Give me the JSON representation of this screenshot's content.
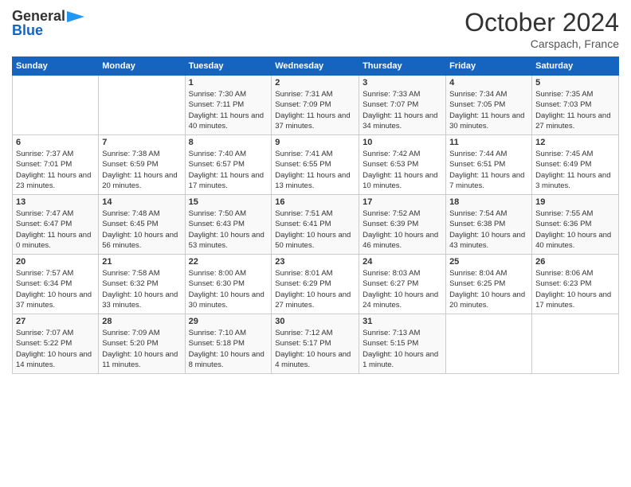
{
  "logo": {
    "general": "General",
    "blue": "Blue"
  },
  "header": {
    "month": "October 2024",
    "location": "Carspach, France"
  },
  "weekdays": [
    "Sunday",
    "Monday",
    "Tuesday",
    "Wednesday",
    "Thursday",
    "Friday",
    "Saturday"
  ],
  "weeks": [
    [
      {
        "day": "",
        "sunrise": "",
        "sunset": "",
        "daylight": ""
      },
      {
        "day": "",
        "sunrise": "",
        "sunset": "",
        "daylight": ""
      },
      {
        "day": "1",
        "sunrise": "Sunrise: 7:30 AM",
        "sunset": "Sunset: 7:11 PM",
        "daylight": "Daylight: 11 hours and 40 minutes."
      },
      {
        "day": "2",
        "sunrise": "Sunrise: 7:31 AM",
        "sunset": "Sunset: 7:09 PM",
        "daylight": "Daylight: 11 hours and 37 minutes."
      },
      {
        "day": "3",
        "sunrise": "Sunrise: 7:33 AM",
        "sunset": "Sunset: 7:07 PM",
        "daylight": "Daylight: 11 hours and 34 minutes."
      },
      {
        "day": "4",
        "sunrise": "Sunrise: 7:34 AM",
        "sunset": "Sunset: 7:05 PM",
        "daylight": "Daylight: 11 hours and 30 minutes."
      },
      {
        "day": "5",
        "sunrise": "Sunrise: 7:35 AM",
        "sunset": "Sunset: 7:03 PM",
        "daylight": "Daylight: 11 hours and 27 minutes."
      }
    ],
    [
      {
        "day": "6",
        "sunrise": "Sunrise: 7:37 AM",
        "sunset": "Sunset: 7:01 PM",
        "daylight": "Daylight: 11 hours and 23 minutes."
      },
      {
        "day": "7",
        "sunrise": "Sunrise: 7:38 AM",
        "sunset": "Sunset: 6:59 PM",
        "daylight": "Daylight: 11 hours and 20 minutes."
      },
      {
        "day": "8",
        "sunrise": "Sunrise: 7:40 AM",
        "sunset": "Sunset: 6:57 PM",
        "daylight": "Daylight: 11 hours and 17 minutes."
      },
      {
        "day": "9",
        "sunrise": "Sunrise: 7:41 AM",
        "sunset": "Sunset: 6:55 PM",
        "daylight": "Daylight: 11 hours and 13 minutes."
      },
      {
        "day": "10",
        "sunrise": "Sunrise: 7:42 AM",
        "sunset": "Sunset: 6:53 PM",
        "daylight": "Daylight: 11 hours and 10 minutes."
      },
      {
        "day": "11",
        "sunrise": "Sunrise: 7:44 AM",
        "sunset": "Sunset: 6:51 PM",
        "daylight": "Daylight: 11 hours and 7 minutes."
      },
      {
        "day": "12",
        "sunrise": "Sunrise: 7:45 AM",
        "sunset": "Sunset: 6:49 PM",
        "daylight": "Daylight: 11 hours and 3 minutes."
      }
    ],
    [
      {
        "day": "13",
        "sunrise": "Sunrise: 7:47 AM",
        "sunset": "Sunset: 6:47 PM",
        "daylight": "Daylight: 11 hours and 0 minutes."
      },
      {
        "day": "14",
        "sunrise": "Sunrise: 7:48 AM",
        "sunset": "Sunset: 6:45 PM",
        "daylight": "Daylight: 10 hours and 56 minutes."
      },
      {
        "day": "15",
        "sunrise": "Sunrise: 7:50 AM",
        "sunset": "Sunset: 6:43 PM",
        "daylight": "Daylight: 10 hours and 53 minutes."
      },
      {
        "day": "16",
        "sunrise": "Sunrise: 7:51 AM",
        "sunset": "Sunset: 6:41 PM",
        "daylight": "Daylight: 10 hours and 50 minutes."
      },
      {
        "day": "17",
        "sunrise": "Sunrise: 7:52 AM",
        "sunset": "Sunset: 6:39 PM",
        "daylight": "Daylight: 10 hours and 46 minutes."
      },
      {
        "day": "18",
        "sunrise": "Sunrise: 7:54 AM",
        "sunset": "Sunset: 6:38 PM",
        "daylight": "Daylight: 10 hours and 43 minutes."
      },
      {
        "day": "19",
        "sunrise": "Sunrise: 7:55 AM",
        "sunset": "Sunset: 6:36 PM",
        "daylight": "Daylight: 10 hours and 40 minutes."
      }
    ],
    [
      {
        "day": "20",
        "sunrise": "Sunrise: 7:57 AM",
        "sunset": "Sunset: 6:34 PM",
        "daylight": "Daylight: 10 hours and 37 minutes."
      },
      {
        "day": "21",
        "sunrise": "Sunrise: 7:58 AM",
        "sunset": "Sunset: 6:32 PM",
        "daylight": "Daylight: 10 hours and 33 minutes."
      },
      {
        "day": "22",
        "sunrise": "Sunrise: 8:00 AM",
        "sunset": "Sunset: 6:30 PM",
        "daylight": "Daylight: 10 hours and 30 minutes."
      },
      {
        "day": "23",
        "sunrise": "Sunrise: 8:01 AM",
        "sunset": "Sunset: 6:29 PM",
        "daylight": "Daylight: 10 hours and 27 minutes."
      },
      {
        "day": "24",
        "sunrise": "Sunrise: 8:03 AM",
        "sunset": "Sunset: 6:27 PM",
        "daylight": "Daylight: 10 hours and 24 minutes."
      },
      {
        "day": "25",
        "sunrise": "Sunrise: 8:04 AM",
        "sunset": "Sunset: 6:25 PM",
        "daylight": "Daylight: 10 hours and 20 minutes."
      },
      {
        "day": "26",
        "sunrise": "Sunrise: 8:06 AM",
        "sunset": "Sunset: 6:23 PM",
        "daylight": "Daylight: 10 hours and 17 minutes."
      }
    ],
    [
      {
        "day": "27",
        "sunrise": "Sunrise: 7:07 AM",
        "sunset": "Sunset: 5:22 PM",
        "daylight": "Daylight: 10 hours and 14 minutes."
      },
      {
        "day": "28",
        "sunrise": "Sunrise: 7:09 AM",
        "sunset": "Sunset: 5:20 PM",
        "daylight": "Daylight: 10 hours and 11 minutes."
      },
      {
        "day": "29",
        "sunrise": "Sunrise: 7:10 AM",
        "sunset": "Sunset: 5:18 PM",
        "daylight": "Daylight: 10 hours and 8 minutes."
      },
      {
        "day": "30",
        "sunrise": "Sunrise: 7:12 AM",
        "sunset": "Sunset: 5:17 PM",
        "daylight": "Daylight: 10 hours and 4 minutes."
      },
      {
        "day": "31",
        "sunrise": "Sunrise: 7:13 AM",
        "sunset": "Sunset: 5:15 PM",
        "daylight": "Daylight: 10 hours and 1 minute."
      },
      {
        "day": "",
        "sunrise": "",
        "sunset": "",
        "daylight": ""
      },
      {
        "day": "",
        "sunrise": "",
        "sunset": "",
        "daylight": ""
      }
    ]
  ]
}
